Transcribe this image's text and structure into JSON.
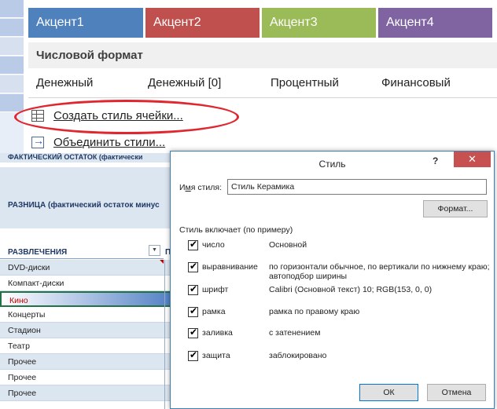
{
  "gallery": {
    "accents": [
      {
        "label": "Акцент1",
        "color": "#4f81bd"
      },
      {
        "label": "Акцент2",
        "color": "#c0504d"
      },
      {
        "label": "Акцент3",
        "color": "#9bbb59"
      },
      {
        "label": "Акцент4",
        "color": "#8064a2"
      }
    ],
    "number_format_header": "Числовой формат",
    "formats": [
      "Денежный",
      "Денежный [0]",
      "Процентный",
      "Финансовый"
    ],
    "commands": {
      "new_style": "Создать стиль ячейки...",
      "merge_styles": "Объединить стили..."
    },
    "highlight_color": "#e0262f"
  },
  "sheet": {
    "top_header": "ФАКТИЧЕСКИЙ ОСТАТОК (фактически",
    "band_label": "РАЗНИЦА (фактический остаток минус",
    "column_header": "РАЗВЛЕЧЕНИЯ",
    "filter_icon": "dropdown-arrow-icon",
    "next_column_letter": "П",
    "rows": [
      "DVD-диски",
      "Компакт-диски",
      "Кино",
      "Концерты",
      "Стадион",
      "Театр",
      "Прочее",
      "Прочее",
      "Прочее"
    ],
    "selected_row": "Кино"
  },
  "dialog": {
    "title": "Стиль",
    "help": "?",
    "close": "✕",
    "name_label_prefix": "И",
    "name_label_underlined": "м",
    "name_label_rest": "я стиля:",
    "style_name": "Стиль Керамика",
    "format_button": "Формат...",
    "group_title": "Стиль включает (по примеру)",
    "options": [
      {
        "name": "число",
        "desc": "Основной",
        "checked": true
      },
      {
        "name": "выравнивание",
        "desc": "по горизонтали обычное, по вертикали по нижнему краю; автоподбор ширины",
        "checked": true
      },
      {
        "name": "шрифт",
        "desc": "Calibri (Основной текст) 10; RGB(153, 0, 0)",
        "checked": true
      },
      {
        "name": "рамка",
        "desc": "рамка по правому краю",
        "checked": true
      },
      {
        "name": "заливка",
        "desc": "с затенением",
        "checked": true
      },
      {
        "name": "защита",
        "desc": "заблокировано",
        "checked": true
      }
    ],
    "ok": "ОК",
    "cancel": "Отмена",
    "close_color": "#c75050"
  }
}
